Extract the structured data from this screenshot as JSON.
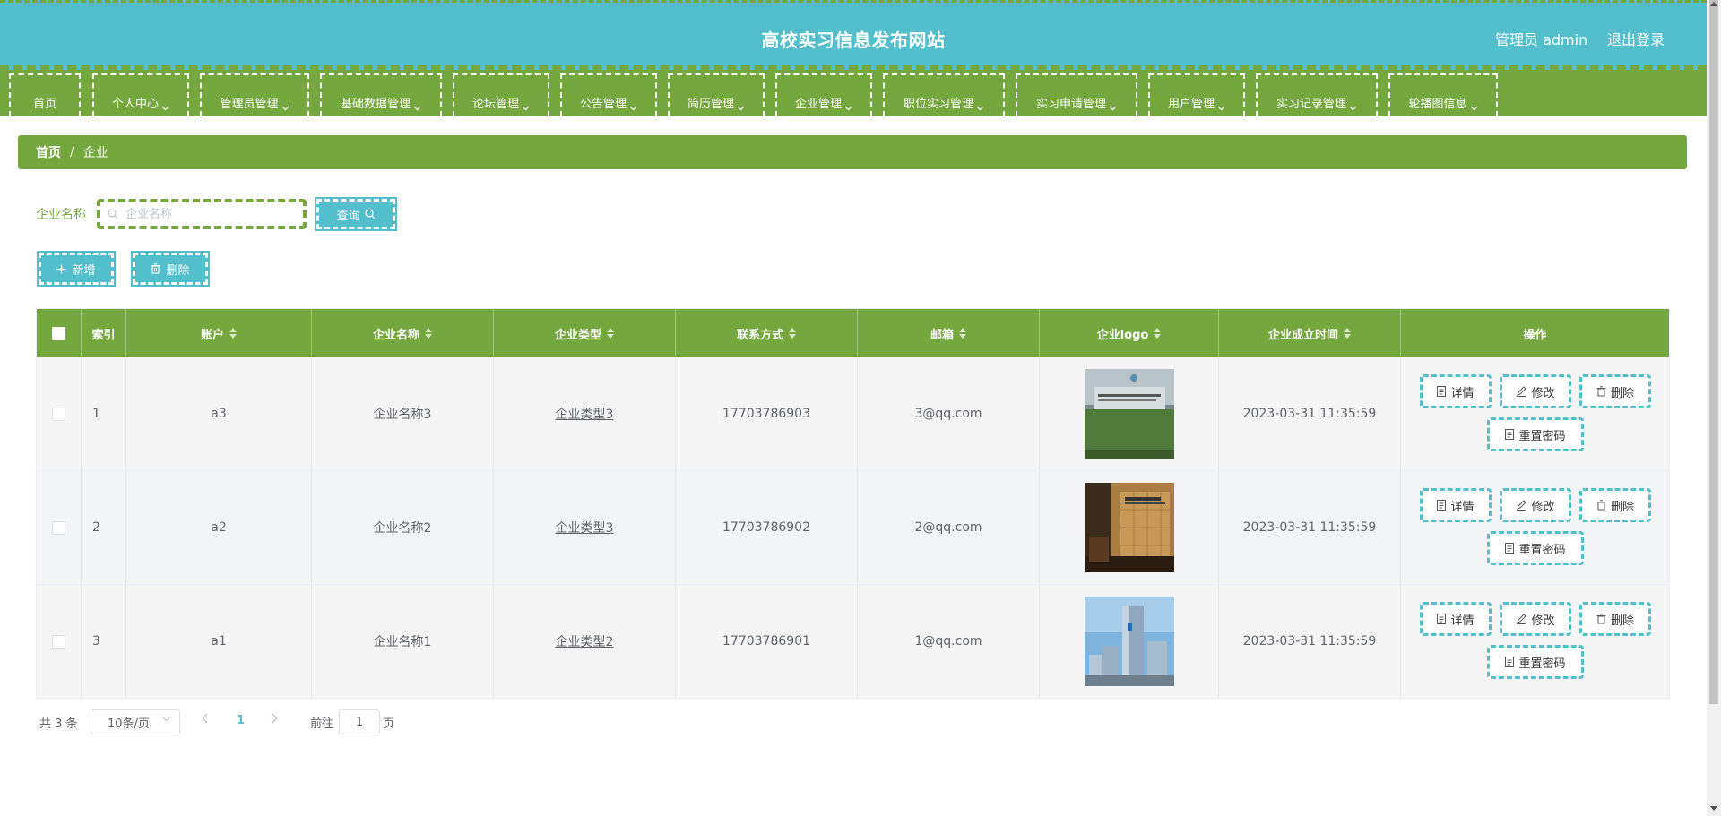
{
  "header": {
    "title": "高校实习信息发布网站",
    "user_label": "管理员 admin",
    "logout_label": "退出登录"
  },
  "nav": {
    "items": [
      {
        "label": "首页"
      },
      {
        "label": "个人中心"
      },
      {
        "label": "管理员管理"
      },
      {
        "label": "基础数据管理"
      },
      {
        "label": "论坛管理"
      },
      {
        "label": "公告管理"
      },
      {
        "label": "简历管理"
      },
      {
        "label": "企业管理"
      },
      {
        "label": "职位实习管理"
      },
      {
        "label": "实习申请管理"
      },
      {
        "label": "用户管理"
      },
      {
        "label": "实习记录管理"
      },
      {
        "label": "轮播图信息"
      }
    ]
  },
  "breadcrumb": {
    "home": "首页",
    "separator": "/",
    "current": "企业"
  },
  "search": {
    "label": "企业名称",
    "placeholder": "企业名称",
    "value": "",
    "button_label": "查询"
  },
  "actions": {
    "add_label": "新增",
    "delete_label": "删除"
  },
  "table": {
    "columns": [
      "索引",
      "账户",
      "企业名称",
      "企业类型",
      "联系方式",
      "邮箱",
      "企业logo",
      "企业成立时间",
      "操作"
    ],
    "rows": [
      {
        "index": "1",
        "account": "a3",
        "name": "企业名称3",
        "type": "企业类型3",
        "phone": "17703786903",
        "email": "3@qq.com",
        "logo": "lobby-wall-image",
        "founded": "2023-03-31 11:35:59"
      },
      {
        "index": "2",
        "account": "a2",
        "name": "企业名称2",
        "type": "企业类型3",
        "phone": "17703786902",
        "email": "2@qq.com",
        "logo": "reception-wall-image",
        "founded": "2023-03-31 11:35:59"
      },
      {
        "index": "3",
        "account": "a1",
        "name": "企业名称1",
        "type": "企业类型2",
        "phone": "17703786901",
        "email": "1@qq.com",
        "logo": "office-tower-image",
        "founded": "2023-03-31 11:35:59"
      }
    ],
    "ops": {
      "detail": "详情",
      "edit": "修改",
      "delete": "删除",
      "reset_password": "重置密码"
    }
  },
  "pagination": {
    "total": "共 3 条",
    "page_size": "10条/页",
    "current_page": "1",
    "goto_prefix": "前往",
    "goto_value": "1",
    "goto_suffix": "页"
  },
  "colors": {
    "header_bg": "#54bfcc",
    "accent_green": "#74a83e",
    "accent_teal": "#54bfcc"
  }
}
